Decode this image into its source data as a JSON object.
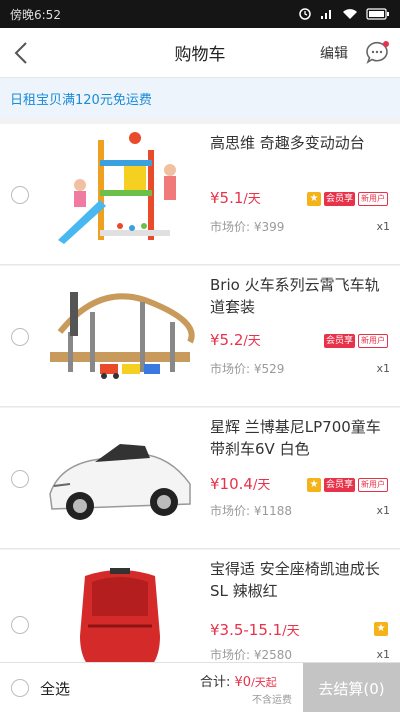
{
  "status_bar": {
    "time": "傍晚6:52"
  },
  "header": {
    "title": "购物车",
    "edit_label": "编辑"
  },
  "banner": {
    "text": "日租宝贝满120元免运费"
  },
  "items": [
    {
      "name": "高思维 奇趣多变动动台",
      "price": "¥5.1",
      "unit": "/天",
      "market_price": "市场价: ¥399",
      "qty": "x1",
      "badges": {
        "star": "★",
        "member": "会员享",
        "new": "新用户"
      }
    },
    {
      "name": "Brio 火车系列云霄飞车轨道套装",
      "price": "¥5.2",
      "unit": "/天",
      "market_price": "市场价: ¥529",
      "qty": "x1",
      "badges": {
        "member": "会员享",
        "new": "新用户"
      }
    },
    {
      "name": "星辉 兰博基尼LP700童车带刹车6V 白色",
      "price": "¥10.4",
      "unit": "/天",
      "market_price": "市场价: ¥1188",
      "qty": "x1",
      "badges": {
        "star": "★",
        "member": "会员享",
        "new": "新用户"
      }
    },
    {
      "name": "宝得适 安全座椅凯迪成长SL 辣椒红",
      "price": "¥3.5-15.1",
      "unit": "/天",
      "market_price": "市场价: ¥2580",
      "qty": "x1",
      "badges": {
        "star": "★"
      }
    }
  ],
  "bottom": {
    "select_all": "全选",
    "total_label": "合计:",
    "total_value": "¥0",
    "total_unit": "/天起",
    "no_fee": "不含运费",
    "checkout": "去结算(0)"
  },
  "colors": {
    "accent": "#e8324a",
    "banner_text": "#1a8bd6",
    "checkout_disabled": "#c4c4c4"
  }
}
